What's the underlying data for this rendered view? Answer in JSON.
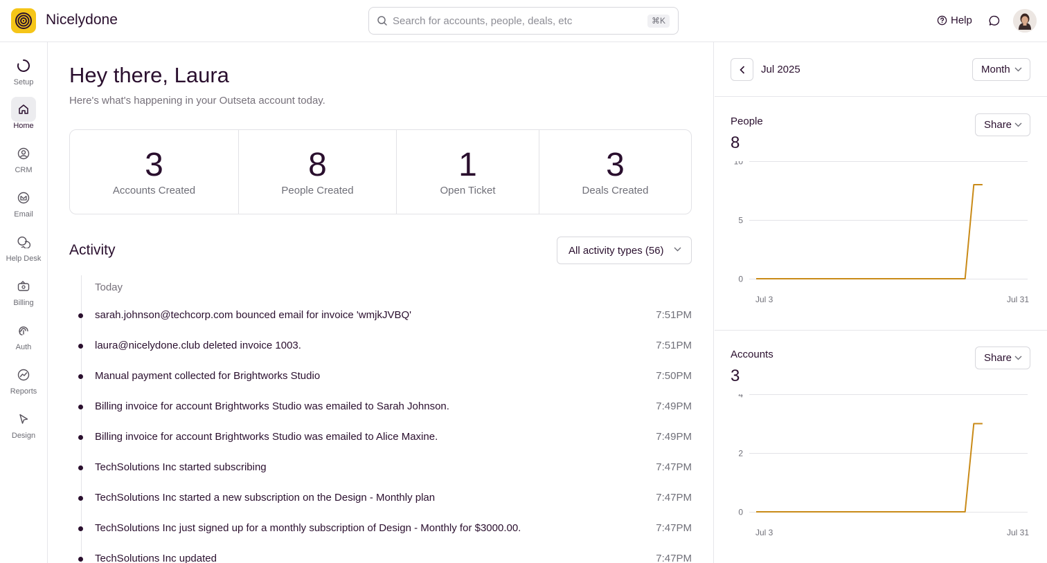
{
  "app": {
    "brand": "Nicelydone"
  },
  "search": {
    "placeholder": "Search for accounts, people, deals, etc",
    "shortcut": "⌘K"
  },
  "header": {
    "help_label": "Help"
  },
  "sidebar": {
    "items": [
      {
        "label": "Setup",
        "icon": "progress-circle-icon"
      },
      {
        "label": "Home",
        "icon": "home-icon",
        "active": true
      },
      {
        "label": "CRM",
        "icon": "user-circle-icon"
      },
      {
        "label": "Email",
        "icon": "email-icon"
      },
      {
        "label": "Help Desk",
        "icon": "chat-bubbles-icon"
      },
      {
        "label": "Billing",
        "icon": "billing-icon"
      },
      {
        "label": "Auth",
        "icon": "fingerprint-icon"
      },
      {
        "label": "Reports",
        "icon": "chart-icon"
      },
      {
        "label": "Design",
        "icon": "cursor-icon"
      }
    ]
  },
  "main": {
    "greeting": "Hey there, Laura",
    "subtitle": "Here's what's happening in your Outseta account today.",
    "stats": [
      {
        "value": "3",
        "label": "Accounts Created"
      },
      {
        "value": "8",
        "label": "People Created"
      },
      {
        "value": "1",
        "label": "Open Ticket"
      },
      {
        "value": "3",
        "label": "Deals Created"
      }
    ],
    "activity": {
      "title": "Activity",
      "filter_label": "All activity types (56)",
      "group_label": "Today",
      "items": [
        {
          "text": "sarah.johnson@techcorp.com bounced email for invoice 'wmjkJVBQ'",
          "time": "7:51PM"
        },
        {
          "text": "laura@nicelydone.club deleted invoice 1003.",
          "time": "7:51PM"
        },
        {
          "text": "Manual payment collected for Brightworks Studio",
          "time": "7:50PM"
        },
        {
          "text": "Billing invoice for account Brightworks Studio was emailed to Sarah Johnson.",
          "time": "7:49PM"
        },
        {
          "text": "Billing invoice for account Brightworks Studio was emailed to Alice Maxine.",
          "time": "7:49PM"
        },
        {
          "text": "TechSolutions Inc started subscribing",
          "time": "7:47PM"
        },
        {
          "text": "TechSolutions Inc started a new subscription on the Design - Monthly plan",
          "time": "7:47PM"
        },
        {
          "text": "TechSolutions Inc just signed up for a monthly subscription of Design - Monthly for $3000.00.",
          "time": "7:47PM"
        },
        {
          "text": "TechSolutions Inc updated",
          "time": "7:47PM"
        }
      ]
    }
  },
  "right_panel": {
    "period": "Jul 2025",
    "granularity": "Month",
    "share_label": "Share",
    "people": {
      "title": "People",
      "value": "8"
    },
    "accounts": {
      "title": "Accounts",
      "value": "3"
    }
  },
  "chart_data": [
    {
      "type": "line",
      "title": "People",
      "x_tick_labels": [
        "Jul 3",
        "Jul 31"
      ],
      "y_ticks": [
        0,
        5,
        10
      ],
      "ylim": [
        0,
        10
      ],
      "color": "#c98a17",
      "x": [
        "Jul 3",
        "Jul 27",
        "Jul 28",
        "Jul 29"
      ],
      "values": [
        0,
        0,
        8,
        8
      ]
    },
    {
      "type": "line",
      "title": "Accounts",
      "x_tick_labels": [
        "Jul 3",
        "Jul 31"
      ],
      "y_ticks": [
        0,
        2,
        4
      ],
      "ylim": [
        0,
        4
      ],
      "color": "#c98a17",
      "x": [
        "Jul 3",
        "Jul 27",
        "Jul 28",
        "Jul 29"
      ],
      "values": [
        0,
        0,
        3,
        3
      ]
    }
  ],
  "colors": {
    "accent": "#f5c518",
    "text": "#2a0f2e",
    "line": "#c98a17"
  }
}
